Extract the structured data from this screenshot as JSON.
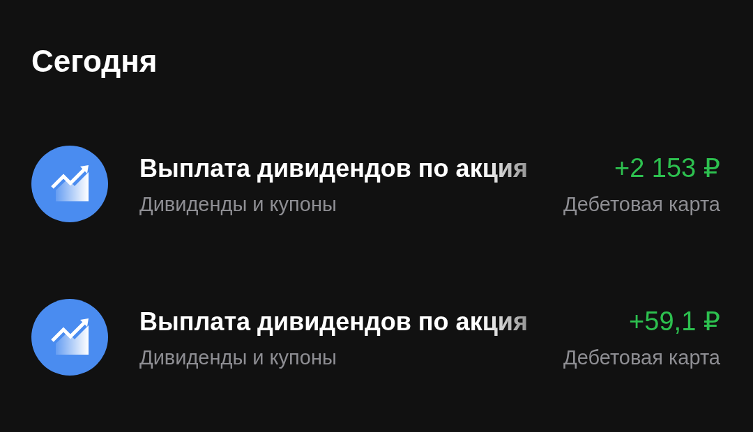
{
  "section": {
    "title": "Сегодня"
  },
  "operations": [
    {
      "title": "Выплата дивидендов по акция",
      "category": "Дивиденды и купоны",
      "amount": "+2 153 ₽",
      "account": "Дебетовая карта"
    },
    {
      "title": "Выплата дивидендов по акция",
      "category": "Дивиденды и купоны",
      "amount": "+59,1 ₽",
      "account": "Дебетовая карта"
    }
  ]
}
